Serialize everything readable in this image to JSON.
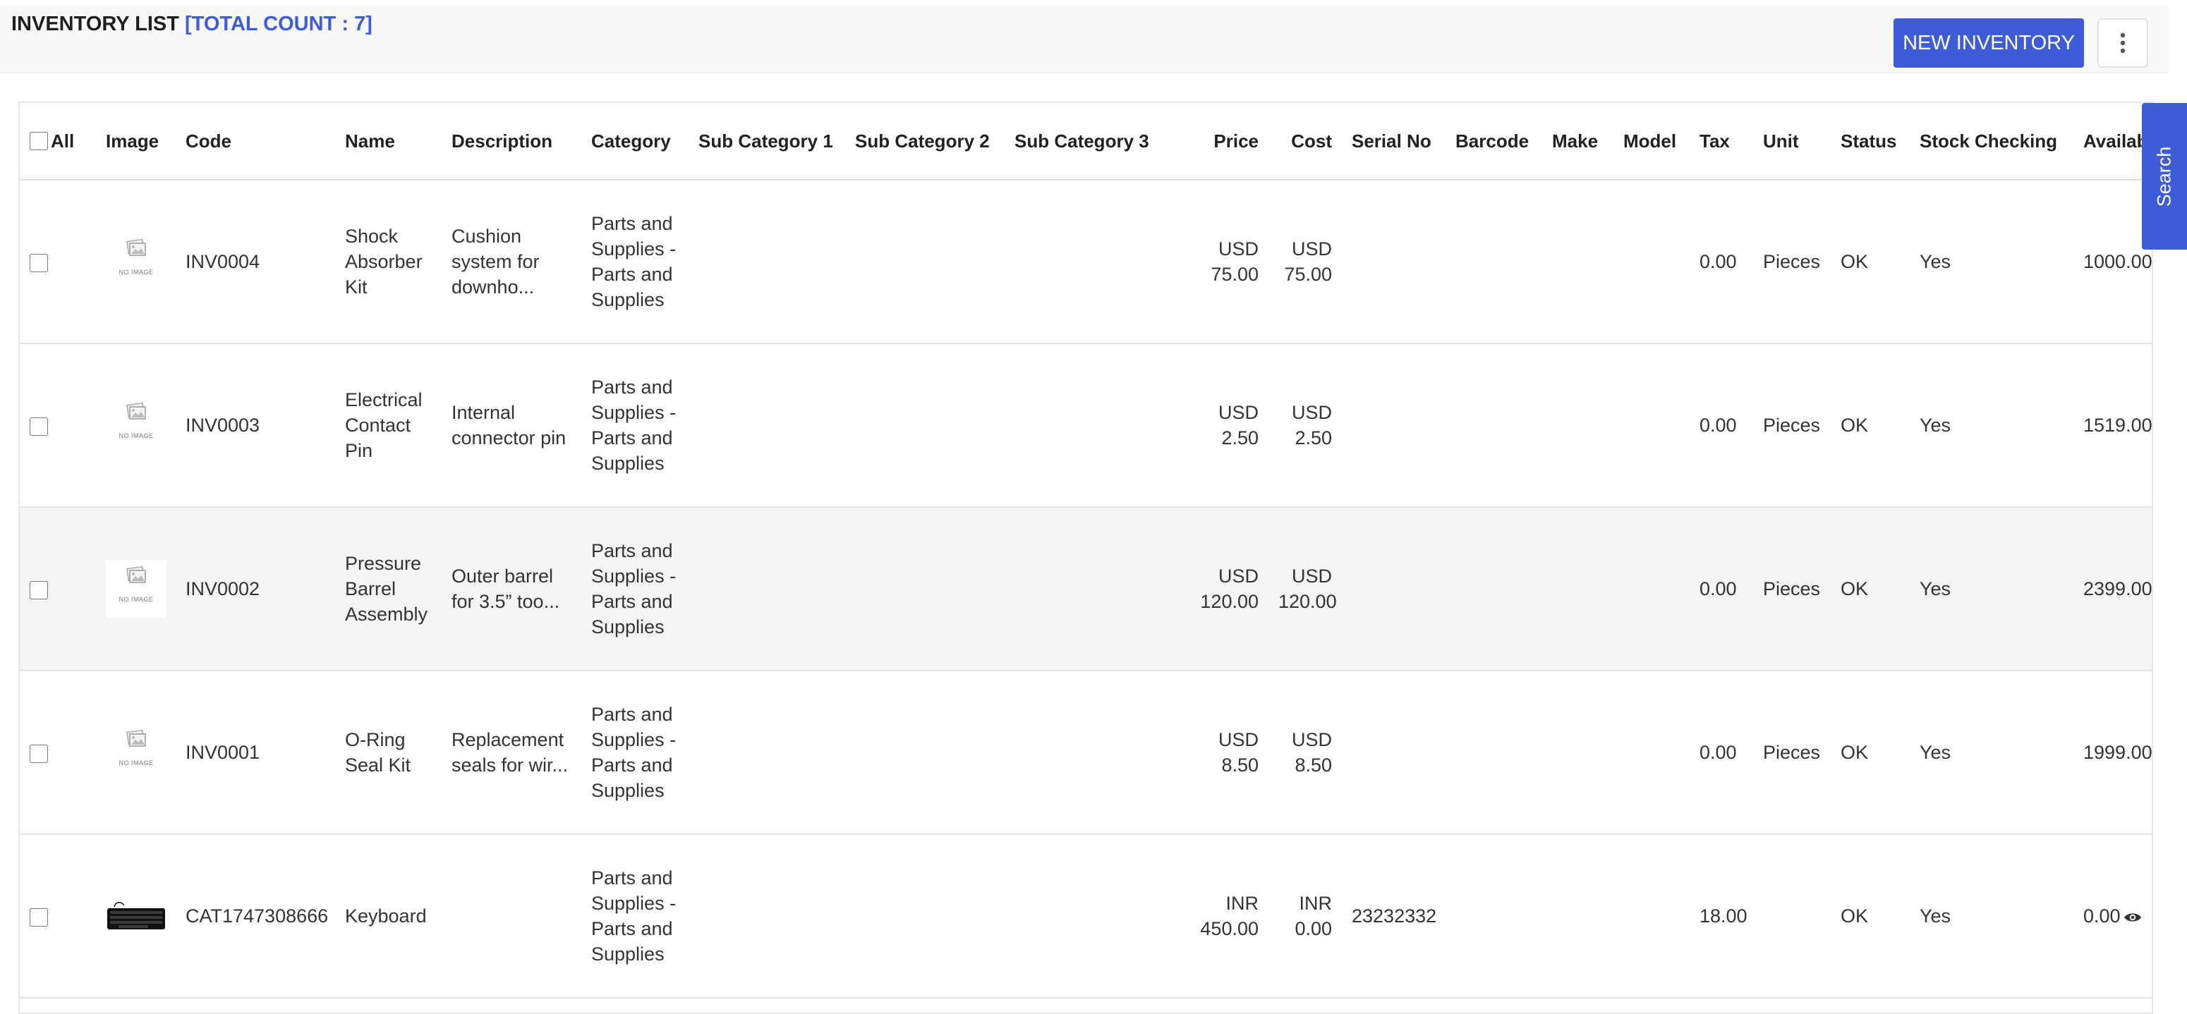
{
  "header": {
    "title": "INVENTORY LIST",
    "count_label": "[TOTAL COUNT : 7]",
    "new_button": "NEW INVENTORY",
    "more_icon": "vertical-ellipsis-icon"
  },
  "search_tab": "Search",
  "table": {
    "columns": {
      "all": "All",
      "image": "Image",
      "code": "Code",
      "name": "Name",
      "description": "Description",
      "category": "Category",
      "sub1": "Sub Category 1",
      "sub2": "Sub Category 2",
      "sub3": "Sub Category 3",
      "price": "Price",
      "cost": "Cost",
      "serial": "Serial No",
      "barcode": "Barcode",
      "make": "Make",
      "model": "Model",
      "tax": "Tax",
      "unit": "Unit",
      "status": "Status",
      "stock": "Stock Checking",
      "available": "Available Qty"
    },
    "no_image_text": "NO IMAGE",
    "rows": [
      {
        "code": "INV0004",
        "name": "Shock Absorber Kit",
        "description": "Cushion system for downho...",
        "category": "Parts and Supplies - Parts and Supplies",
        "sub1": "",
        "sub2": "",
        "sub3": "",
        "price_cur": "USD",
        "price": "75.00",
        "cost_cur": "USD",
        "cost": "75.00",
        "serial": "",
        "barcode": "",
        "make": "",
        "model": "",
        "tax": "0.00",
        "unit": "Pieces",
        "status": "OK",
        "stock": "Yes",
        "available": "1000.00",
        "image": "no-image"
      },
      {
        "code": "INV0003",
        "name": "Electrical Contact Pin",
        "description": "Internal connector pin",
        "category": "Parts and Supplies - Parts and Supplies",
        "sub1": "",
        "sub2": "",
        "sub3": "",
        "price_cur": "USD",
        "price": "2.50",
        "cost_cur": "USD",
        "cost": "2.50",
        "serial": "",
        "barcode": "",
        "make": "",
        "model": "",
        "tax": "0.00",
        "unit": "Pieces",
        "status": "OK",
        "stock": "Yes",
        "available": "1519.00",
        "image": "no-image"
      },
      {
        "code": "INV0002",
        "name": "Pressure Barrel Assembly",
        "description": "Outer barrel for 3.5” too...",
        "category": "Parts and Supplies - Parts and Supplies",
        "sub1": "",
        "sub2": "",
        "sub3": "",
        "price_cur": "USD",
        "price": "120.00",
        "cost_cur": "USD",
        "cost": "120.00",
        "serial": "",
        "barcode": "",
        "make": "",
        "model": "",
        "tax": "0.00",
        "unit": "Pieces",
        "status": "OK",
        "stock": "Yes",
        "available": "2399.00",
        "image": "no-image"
      },
      {
        "code": "INV0001",
        "name": "O-Ring Seal Kit",
        "description": "Replacement seals for wir...",
        "category": "Parts and Supplies - Parts and Supplies",
        "sub1": "",
        "sub2": "",
        "sub3": "",
        "price_cur": "USD",
        "price": "8.50",
        "cost_cur": "USD",
        "cost": "8.50",
        "serial": "",
        "barcode": "",
        "make": "",
        "model": "",
        "tax": "0.00",
        "unit": "Pieces",
        "status": "OK",
        "stock": "Yes",
        "available": "1999.00",
        "image": "no-image"
      },
      {
        "code": "CAT1747308666",
        "name": "Keyboard",
        "description": "",
        "category": "Parts and Supplies - Parts and Supplies",
        "sub1": "",
        "sub2": "",
        "sub3": "",
        "price_cur": "INR",
        "price": "450.00",
        "cost_cur": "INR",
        "cost": "0.00",
        "serial": "23232332",
        "barcode": "",
        "make": "",
        "model": "",
        "tax": "18.00",
        "unit": "",
        "status": "OK",
        "stock": "Yes",
        "available": "0.00",
        "image": "keyboard"
      }
    ]
  },
  "colors": {
    "accent": "#3e5bd8",
    "count": "#3f5bd6",
    "row_alt": "#f4f4f4"
  }
}
